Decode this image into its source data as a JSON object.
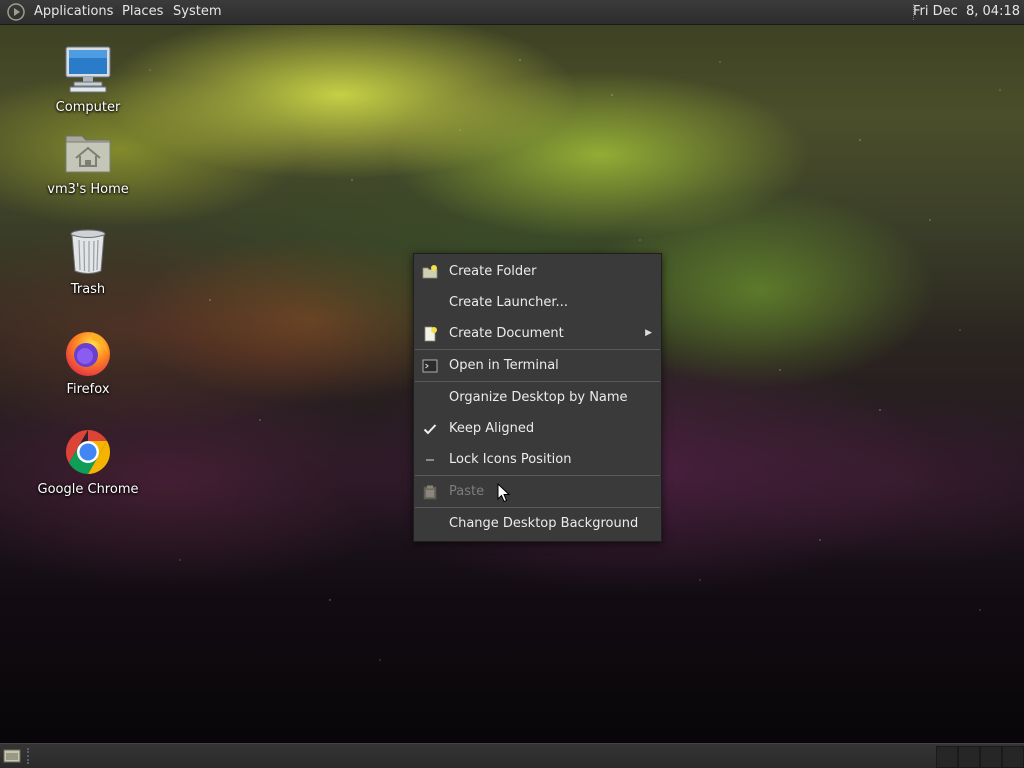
{
  "top_panel": {
    "menus": [
      "Applications",
      "Places",
      "System"
    ],
    "clock": "Fri Dec  8, 04:18"
  },
  "desktop": {
    "icons": [
      {
        "label": "Computer",
        "icon": "computer-icon"
      },
      {
        "label": "vm3's Home",
        "icon": "home-folder-icon"
      },
      {
        "label": "Trash",
        "icon": "trash-icon"
      },
      {
        "label": "Firefox",
        "icon": "firefox-icon"
      },
      {
        "label": "Google Chrome",
        "icon": "chrome-icon"
      }
    ]
  },
  "context_menu": {
    "items": [
      {
        "label": "Create Folder",
        "icon": "new-folder-icon"
      },
      {
        "label": "Create Launcher...",
        "icon": ""
      },
      {
        "label": "Create Document",
        "icon": "new-document-icon",
        "submenu": true
      },
      {
        "label": "Open in Terminal",
        "icon": "terminal-icon"
      },
      {
        "label": "Organize Desktop by Name",
        "icon": ""
      },
      {
        "label": "Keep Aligned",
        "icon": "checkmark-icon",
        "checked": true
      },
      {
        "label": "Lock Icons Position",
        "icon": "checkbox-unchecked-icon",
        "checked": false
      },
      {
        "label": "Paste",
        "icon": "paste-icon",
        "disabled": true
      },
      {
        "label": "Change Desktop Background",
        "icon": ""
      }
    ]
  },
  "bottom_panel": {
    "workspaces": 4
  },
  "colors": {
    "panel": "#2d2d2d",
    "menu_bg": "#3a3a3a",
    "menu_text": "#ececec",
    "disabled_text": "#7d7d7d"
  }
}
